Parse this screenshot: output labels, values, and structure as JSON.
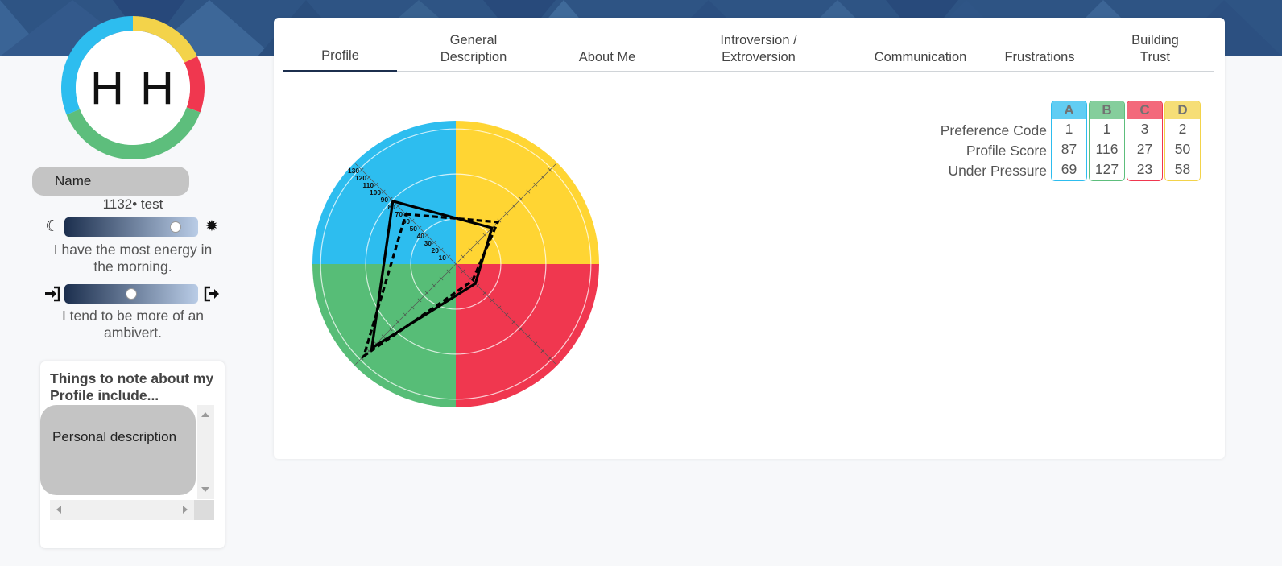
{
  "profile": {
    "initials": "H H",
    "name_label": "Name",
    "user_id": "1132• test",
    "ring_colors": [
      "#f3d34a",
      "#f0374f",
      "#5dbe7c",
      "#2dbdef"
    ]
  },
  "energy_slider": {
    "left_icon": "moon-icon",
    "right_icon": "sun-icon",
    "value": 0.83,
    "caption": "I have the most energy in the morning."
  },
  "intro_slider": {
    "left_icon": "sign-in-icon",
    "right_icon": "sign-out-icon",
    "value": 0.5,
    "caption": "I tend to be more of an ambivert."
  },
  "notes": {
    "title": "Things to note about my Profile include...",
    "items": [
      "Personal description"
    ]
  },
  "tabs": [
    {
      "label": "Profile",
      "active": true
    },
    {
      "label": "General\nDescription",
      "active": false
    },
    {
      "label": "About Me",
      "active": false
    },
    {
      "label": "Introversion /\nExtroversion",
      "active": false
    },
    {
      "label": "Communication",
      "active": false
    },
    {
      "label": "Frustrations",
      "active": false
    },
    {
      "label": "Building\nTrust",
      "active": false
    }
  ],
  "score_table": {
    "row_labels": [
      "Preference Code",
      "Profile Score",
      "Under Pressure"
    ],
    "columns": [
      {
        "header": "A",
        "color": "#2dbdef",
        "values": [
          "1",
          "87",
          "69"
        ]
      },
      {
        "header": "B",
        "color": "#5dbe7c",
        "values": [
          "1",
          "116",
          "127"
        ]
      },
      {
        "header": "C",
        "color": "#f0374f",
        "values": [
          "3",
          "27",
          "23"
        ]
      },
      {
        "header": "D",
        "color": "#f3d34a",
        "values": [
          "2",
          "50",
          "58"
        ]
      }
    ]
  },
  "chart_data": {
    "type": "radar",
    "quadrant_colors": {
      "A": "#2dbdef",
      "D": "#ffd533",
      "C": "#f0374f",
      "B": "#57bd77"
    },
    "scale_labels": [
      "10",
      "20",
      "30",
      "40",
      "50",
      "60",
      "70",
      "80",
      "90",
      "100",
      "110",
      "120",
      "130"
    ],
    "axis_max": 140,
    "series": [
      {
        "name": "Profile Score",
        "style": "solid",
        "values": {
          "A": 87,
          "D": 50,
          "C": 27,
          "B": 116
        }
      },
      {
        "name": "Under Pressure",
        "style": "dashed",
        "values": {
          "A": 69,
          "D": 58,
          "C": 23,
          "B": 127
        }
      }
    ]
  }
}
